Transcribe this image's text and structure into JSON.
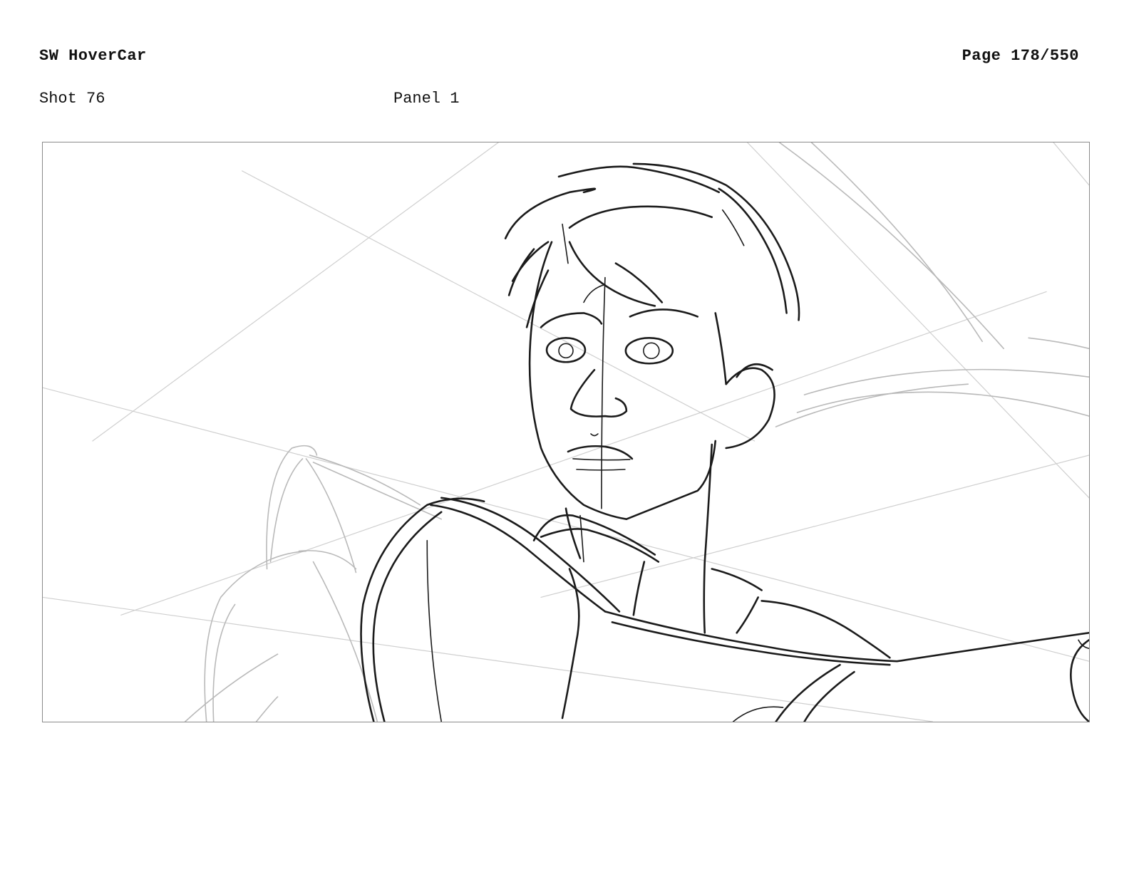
{
  "header": {
    "project_title": "SW HoverCar",
    "page_number": "Page 178/550"
  },
  "panel_info": {
    "shot_label": "Shot 76",
    "panel_label": "Panel 1"
  },
  "colors": {
    "ink": "#1b1b1b",
    "construction_lines": "#b9b9b9",
    "frame_border": "#8a8a8a",
    "background": "#ffffff"
  }
}
